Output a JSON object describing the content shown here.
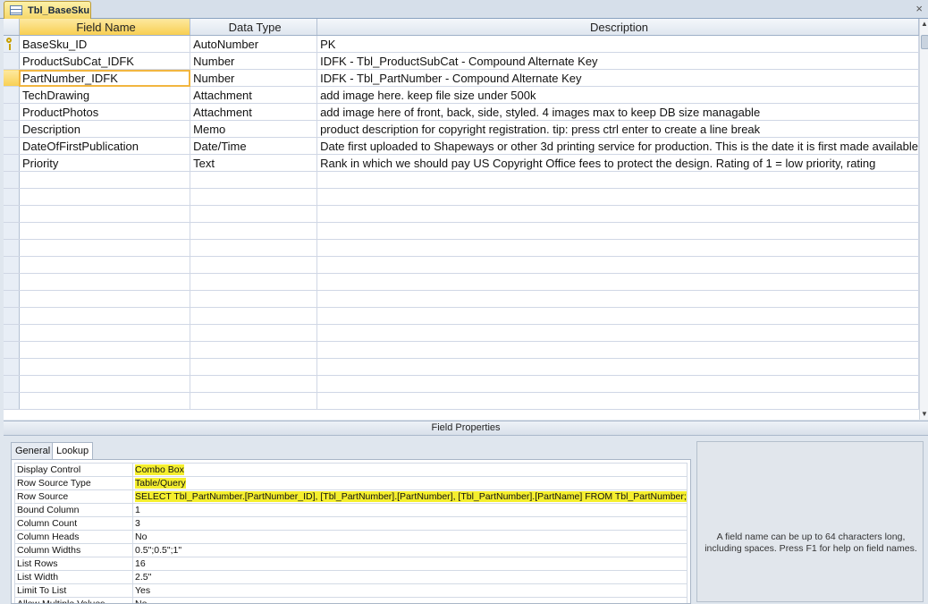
{
  "tab": {
    "title": "Tbl_BaseSku",
    "close": "×"
  },
  "grid": {
    "headers": {
      "field_name": "Field Name",
      "data_type": "Data Type",
      "description": "Description"
    },
    "rows": [
      {
        "name": "BaseSku_ID",
        "type": "AutoNumber",
        "desc": "PK"
      },
      {
        "name": "ProductSubCat_IDFK",
        "type": "Number",
        "desc": "IDFK - Tbl_ProductSubCat - Compound Alternate Key"
      },
      {
        "name": "PartNumber_IDFK",
        "type": "Number",
        "desc": "IDFK - Tbl_PartNumber - Compound Alternate Key"
      },
      {
        "name": "TechDrawing",
        "type": "Attachment",
        "desc": "add image here. keep file size under 500k"
      },
      {
        "name": "ProductPhotos",
        "type": "Attachment",
        "desc": "add image here of front, back, side, styled. 4 images max to keep DB size managable"
      },
      {
        "name": "Description",
        "type": "Memo",
        "desc": "product description for copyright registration. tip: press ctrl enter to create a line break"
      },
      {
        "name": "DateOfFirstPublication",
        "type": "Date/Time",
        "desc": "Date first uploaded to Shapeways or other 3d printing service for production. This is the date it is first made available"
      },
      {
        "name": "Priority",
        "type": "Text",
        "desc": "Rank in which we should pay US Copyright Office fees to protect the design. Rating of 1 = low priority, rating"
      }
    ]
  },
  "field_properties": {
    "title": "Field Properties",
    "tabs": [
      "General",
      "Lookup"
    ],
    "props": [
      {
        "label": "Display Control",
        "value": "Combo Box"
      },
      {
        "label": "Row Source Type",
        "value": "Table/Query"
      },
      {
        "label": "Row Source",
        "value": "SELECT Tbl_PartNumber.[PartNumber_ID], [Tbl_PartNumber].[PartNumber], [Tbl_PartNumber].[PartName] FROM Tbl_PartNumber;"
      },
      {
        "label": "Bound Column",
        "value": "1"
      },
      {
        "label": "Column Count",
        "value": "3"
      },
      {
        "label": "Column Heads",
        "value": "No"
      },
      {
        "label": "Column Widths",
        "value": "0.5\";0.5\";1\""
      },
      {
        "label": "List Rows",
        "value": "16"
      },
      {
        "label": "List Width",
        "value": "2.5\""
      },
      {
        "label": "Limit To List",
        "value": "Yes"
      },
      {
        "label": "Allow Multiple Values",
        "value": "No"
      }
    ],
    "help": "A field name can be up to 64 characters long, including spaces. Press F1 for help on field names."
  },
  "colors": {
    "highlight": "#f5ef2e",
    "selection": "#f8cf52"
  }
}
